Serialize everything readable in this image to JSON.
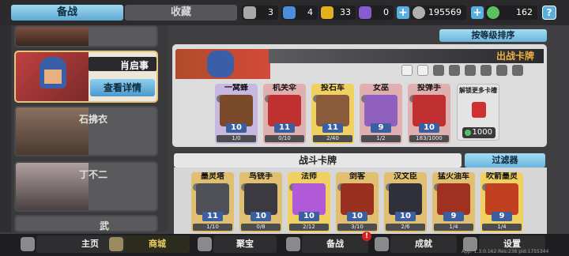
{
  "tabs": {
    "active": "备战",
    "inactive": "收藏"
  },
  "resources": [
    {
      "icon": "silver-shield-icon",
      "value": "3",
      "color": "#a8a8a8"
    },
    {
      "icon": "blue-shield-icon",
      "value": "4",
      "color": "#4a8fd8"
    },
    {
      "icon": "gold-shield-icon",
      "value": "33",
      "color": "#e0b020"
    },
    {
      "icon": "purple-shield-icon",
      "value": "0",
      "color": "#8a5ad0"
    },
    {
      "icon": "coin-icon",
      "value": "195569",
      "color": "#b0b0b0"
    },
    {
      "icon": "gem-icon",
      "value": "162",
      "color": "#5ac060"
    }
  ],
  "help": "?",
  "sort_button": "按等级排序",
  "sidebar": {
    "selected": {
      "name": "肖启事",
      "detail_button": "查看详情"
    },
    "others": [
      {
        "name": "石拂衣"
      },
      {
        "name": "丁不二"
      },
      {
        "name": "武"
      }
    ]
  },
  "battle_cards_title": "出战卡牌",
  "unlock": {
    "label": "解锁更多卡槽",
    "cost": "1000"
  },
  "battle_cards": [
    {
      "name": "一窝蜂",
      "level": "10",
      "progress": "1/0",
      "color": "#c8b8e0",
      "art": "#7a4a2a"
    },
    {
      "name": "机关伞",
      "level": "11",
      "progress": "0/10",
      "color": "#e0b0b0",
      "art": "#c03030"
    },
    {
      "name": "投石车",
      "level": "11",
      "progress": "2/40",
      "color": "#f0d060",
      "art": "#8a5a3a"
    },
    {
      "name": "女巫",
      "level": "9",
      "progress": "1/2",
      "color": "#e0b0b0",
      "art": "#9060c0"
    },
    {
      "name": "投弹手",
      "level": "10",
      "progress": "183/1000",
      "color": "#e0b0b0",
      "art": "#c03030"
    }
  ],
  "deck_title": "战斗卡牌",
  "filter_button": "过滤器",
  "deck_cards": [
    {
      "name": "墨灵塔",
      "level": "11",
      "progress": "1/10",
      "color": "#e0c070",
      "art": "#505058"
    },
    {
      "name": "鸟铳手",
      "level": "10",
      "progress": "0/8",
      "color": "#e0c070",
      "art": "#3a3a40"
    },
    {
      "name": "法师",
      "level": "10",
      "progress": "2/12",
      "color": "#f0d060",
      "art": "#b05ad8"
    },
    {
      "name": "剑客",
      "level": "10",
      "progress": "3/10",
      "color": "#e0c070",
      "art": "#9a3020"
    },
    {
      "name": "汉文臣",
      "level": "10",
      "progress": "2/6",
      "color": "#e0c070",
      "art": "#30303a"
    },
    {
      "name": "猛火油车",
      "level": "9",
      "progress": "1/4",
      "color": "#e0c070",
      "art": "#a03020"
    },
    {
      "name": "吹箭墨灵",
      "level": "9",
      "progress": "1/4",
      "color": "#f0d060",
      "art": "#c04020"
    }
  ],
  "nav": [
    {
      "label": "主页",
      "icon": "home-icon",
      "active": false
    },
    {
      "label": "商城",
      "icon": "shop-icon",
      "active": true
    },
    {
      "label": "聚宝",
      "icon": "treasure-icon",
      "active": false
    },
    {
      "label": "备战",
      "icon": "cards-icon",
      "active": false,
      "badge": "!"
    },
    {
      "label": "成就",
      "icon": "achievement-icon",
      "active": false
    },
    {
      "label": "设置",
      "icon": "gear-icon",
      "active": false
    }
  ],
  "version": "App: 1.3.0.162 Res:238 pid:1755344"
}
